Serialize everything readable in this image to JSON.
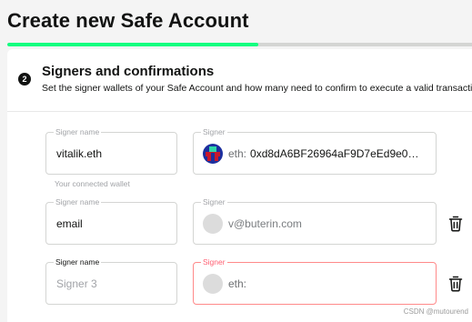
{
  "page": {
    "title": "Create new Safe Account",
    "progress": 0.54
  },
  "step": {
    "number": "2",
    "title": "Signers and confirmations",
    "description": "Set the signer wallets of your Safe Account and how many need to confirm to execute a valid transaction."
  },
  "signers": [
    {
      "name_label": "Signer name",
      "name_value": "vitalik.eth",
      "helper": "Your connected wallet",
      "address_label": "Signer",
      "prefix": "eth:",
      "address": "0xd8dA6BF26964aF9D7eEd9e0…",
      "avatar": "identicon"
    },
    {
      "name_label": "Signer name",
      "name_value": "email",
      "address_label": "Signer",
      "address": "v@buterin.com",
      "delete_icon": "trash-icon"
    },
    {
      "name_label": "Signer name",
      "name_placeholder": "Signer 3",
      "address_label": "Signer",
      "prefix": "eth:",
      "delete_icon": "trash-icon"
    }
  ],
  "colors": {
    "accent": "#12ff80",
    "error": "#ff5f72",
    "text": "#121312"
  },
  "watermark": "CSDN @mutourend"
}
